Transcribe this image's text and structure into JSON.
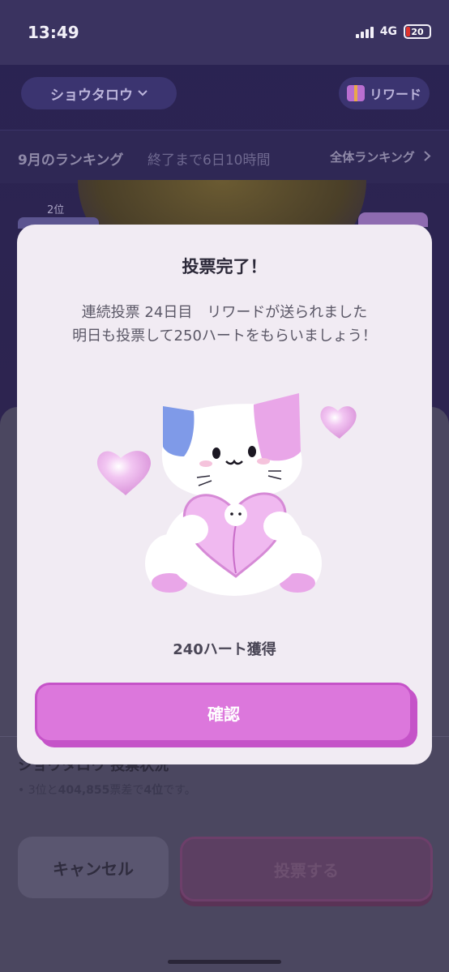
{
  "status_bar": {
    "time": "13:49",
    "network": "4G",
    "battery": "20"
  },
  "header": {
    "group_name": "ショウタロウ",
    "reward_label": "リワード"
  },
  "ranking": {
    "title": "9月のランキング",
    "remaining": "終了まで6日10時間",
    "all_label": "全体ランキング"
  },
  "podium": {
    "second_label": "2位"
  },
  "vote_status": {
    "title": "ショウタロウ 投票状況",
    "line_prefix": "• 3位と",
    "gap_votes": "404,855",
    "line_mid": "票差で",
    "rank": "4位",
    "line_suffix": "です。"
  },
  "buttons": {
    "cancel": "キャンセル",
    "vote": "投票する",
    "confirm": "確認"
  },
  "modal": {
    "title": "投票完了！",
    "message_line1": "連続投票 24日目　リワードが送られました",
    "message_line2": "明日も投票して250ハートをもらいましょう！",
    "result": "240ハート獲得"
  },
  "colors": {
    "accent": "#dc77dc",
    "accent_dark": "#c553c8",
    "modal_bg": "#f1ebf3",
    "cat_blue": "#7f9ae8",
    "cat_pink": "#e9a6e8"
  },
  "icons": [
    "signal-icon",
    "battery-icon",
    "chevron-down-icon",
    "gift-icon",
    "chevron-right-icon",
    "cat-mascot-illustration"
  ]
}
